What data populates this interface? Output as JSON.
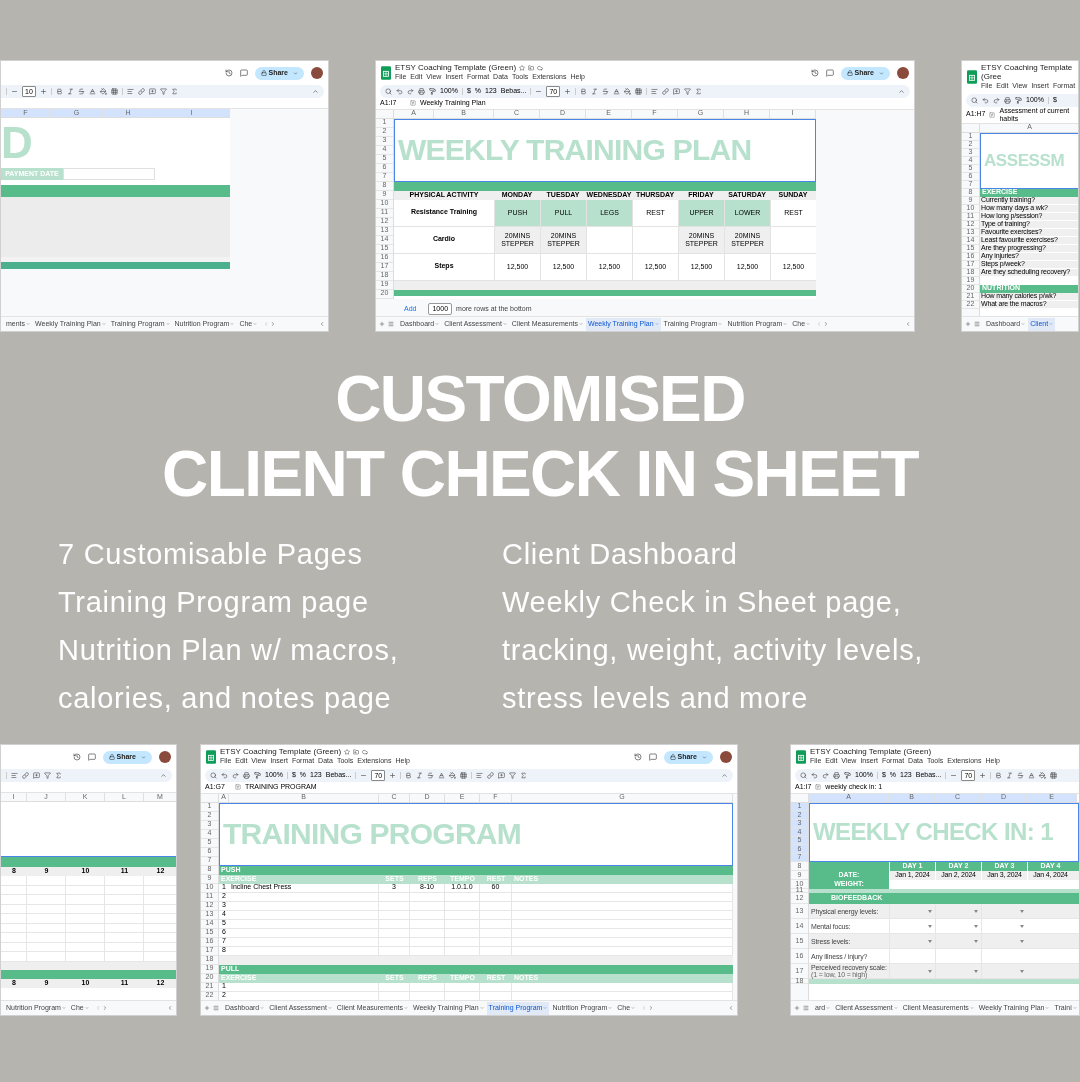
{
  "top_panels": [
    {
      "share": "Share",
      "toolbar": {
        "size": "10"
      },
      "body": {
        "kind": "dashboard",
        "columns": [
          "F",
          "G",
          "H",
          "I"
        ],
        "title": "D",
        "field_label": "PAYMENT DATE"
      },
      "tabs": [
        {
          "label": "ments",
          "selected": false
        },
        {
          "label": "Weekly Training Plan",
          "selected": false
        },
        {
          "label": "Training Program",
          "selected": false
        },
        {
          "label": "Nutrition Program",
          "selected": false
        },
        {
          "label": "Che",
          "selected": false
        }
      ]
    },
    {
      "doc_title": "ETSY Coaching Template (Green)",
      "menu": [
        "File",
        "Edit",
        "View",
        "Insert",
        "Format",
        "Data",
        "Tools",
        "Extensions",
        "Help"
      ],
      "share": "Share",
      "toolbar": {
        "zoom": "100%",
        "currency": "$",
        "percent": "%",
        "number_format": "123",
        "font": "Bebas...",
        "size": "70"
      },
      "formula": {
        "cell": "A1:I7",
        "text": "Weekly Training Plan"
      },
      "body": {
        "kind": "weekly_plan",
        "columns": [
          "A",
          "B",
          "C",
          "D",
          "E",
          "F",
          "G",
          "H",
          "I"
        ],
        "row_numbers": [
          "1",
          "2",
          "3",
          "4",
          "5",
          "6",
          "7",
          "8",
          "9",
          "10",
          "11",
          "12",
          "13",
          "14",
          "15",
          "16",
          "17",
          "18",
          "19",
          "20"
        ],
        "title": "WEEKLY TRAINING PLAN",
        "header": [
          "PHYSICAL ACTIVITY",
          "MONDAY",
          "TUESDAY",
          "WEDNESDAY",
          "THURSDAY",
          "FRIDAY",
          "SATURDAY",
          "SUNDAY"
        ],
        "activities": [
          {
            "name": "Resistance Training",
            "cells": [
              {
                "text": "PUSH",
                "highlighted": true,
                "shaded": false
              },
              {
                "text": "PULL",
                "highlighted": true,
                "shaded": false
              },
              {
                "text": "LEGS",
                "highlighted": true,
                "shaded": false
              },
              {
                "text": "REST",
                "highlighted": false,
                "shaded": false
              },
              {
                "text": "UPPER",
                "highlighted": true,
                "shaded": false
              },
              {
                "text": "LOWER",
                "highlighted": true,
                "shaded": false
              },
              {
                "text": "REST",
                "highlighted": false,
                "shaded": false
              }
            ]
          },
          {
            "name": "Cardio",
            "cells": [
              {
                "text": "20MINS STEPPER",
                "highlighted": false,
                "shaded": true
              },
              {
                "text": "20MINS STEPPER",
                "highlighted": false,
                "shaded": true
              },
              {
                "highlighted": false,
                "shaded": false
              },
              {
                "highlighted": false,
                "shaded": false
              },
              {
                "text": "20MINS STEPPER",
                "highlighted": false,
                "shaded": true
              },
              {
                "text": "20MINS STEPPER",
                "highlighted": false,
                "shaded": true
              },
              {
                "highlighted": false,
                "shaded": false
              }
            ]
          },
          {
            "name": "Steps",
            "cells": [
              {
                "text": "12,500",
                "highlighted": false,
                "shaded": false
              },
              {
                "text": "12,500",
                "highlighted": false,
                "shaded": false
              },
              {
                "text": "12,500",
                "highlighted": false,
                "shaded": false
              },
              {
                "text": "12,500",
                "highlighted": false,
                "shaded": false
              },
              {
                "text": "12,500",
                "highlighted": false,
                "shaded": false
              },
              {
                "text": "12,500",
                "highlighted": false,
                "shaded": false
              },
              {
                "text": "12,500",
                "highlighted": false,
                "shaded": false
              }
            ]
          }
        ],
        "add_rows": {
          "button": "Add",
          "count": "1000",
          "text": "more rows at the bottom"
        }
      },
      "tabs": [
        {
          "label": "Dashboard",
          "selected": false
        },
        {
          "label": "Client Assessment",
          "selected": false
        },
        {
          "label": "Client Measurements",
          "selected": false
        },
        {
          "label": "Weekly Training Plan",
          "selected": true
        },
        {
          "label": "Training Program",
          "selected": false
        },
        {
          "label": "Nutrition Program",
          "selected": false
        },
        {
          "label": "Che",
          "selected": false
        }
      ]
    },
    {
      "doc_title": "ETSY Coaching Template (Gree",
      "menu": [
        "File",
        "Edit",
        "View",
        "Insert",
        "Format"
      ],
      "toolbar": {
        "zoom": "100%",
        "currency": "$"
      },
      "formula": {
        "cell": "A1:H7",
        "text": "Assessment of current habits"
      },
      "body": {
        "kind": "assessment",
        "columns": [
          "A"
        ],
        "row_numbers": [
          "1",
          "2",
          "3",
          "4",
          "5",
          "6",
          "7",
          "8",
          "9",
          "10",
          "11",
          "12",
          "13",
          "14",
          "15",
          "16",
          "17",
          "18",
          "19",
          "20",
          "21",
          "22"
        ],
        "title": "ASSESSM",
        "sections": [
          {
            "name": "EXERCISE",
            "questions": [
              "Currently training?",
              "How many days a wk?",
              "How long p/session?",
              "Type of training?",
              "Favourite exercises?",
              "Least favourite exercises?",
              "Are they progressing?",
              "Any injuries?",
              "Steps p/week?",
              "Are they scheduling recovery?"
            ]
          },
          {
            "name": "NUTRITION",
            "questions": [
              "How many calories p/wk?",
              "What are the macros?"
            ]
          }
        ]
      },
      "tabs": [
        {
          "label": "Dashboard",
          "selected": false
        },
        {
          "label": "Client",
          "selected": true
        }
      ]
    }
  ],
  "headline": [
    "CUSTOMISED",
    "CLIENT CHECK IN SHEET"
  ],
  "features_left": [
    "7 Customisable Pages",
    "Training Program page",
    "Nutrition Plan w/ macros,",
    "calories, and notes page"
  ],
  "features_right": [
    "Client Dashboard",
    "Weekly Check in Sheet page,",
    "tracking, weight, activity levels,",
    "stress levels and more"
  ],
  "bottom_panels": [
    {
      "share": "Share",
      "body": {
        "kind": "week_grid",
        "columns": [
          "I",
          "J",
          "K",
          "L",
          "M"
        ],
        "bands": [
          [
            "8",
            "9",
            "10",
            "11",
            "12"
          ],
          [
            "8",
            "9",
            "10",
            "11",
            "12"
          ]
        ]
      },
      "tabs": [
        {
          "label": "Nutrition Program",
          "selected": false
        },
        {
          "label": "Che",
          "selected": false
        }
      ]
    },
    {
      "doc_title": "ETSY Coaching Template (Green)",
      "menu": [
        "File",
        "Edit",
        "View",
        "Insert",
        "Format",
        "Data",
        "Tools",
        "Extensions",
        "Help"
      ],
      "share": "Share",
      "toolbar": {
        "zoom": "100%",
        "currency": "$",
        "percent": "%",
        "number_format": "123",
        "font": "Bebas...",
        "size": "70"
      },
      "formula": {
        "cell": "A1:G7",
        "text": "TRAINING PROGRAM"
      },
      "body": {
        "kind": "training",
        "columns": [
          "A",
          "B",
          "C",
          "D",
          "E",
          "F",
          "G"
        ],
        "row_numbers": [
          "1",
          "2",
          "3",
          "4",
          "5",
          "6",
          "7",
          "8",
          "9",
          "10",
          "11",
          "12",
          "13",
          "14",
          "15",
          "16",
          "17",
          "18",
          "19",
          "20",
          "21",
          "22"
        ],
        "title": "TRAINING PROGRAM",
        "sections": [
          {
            "name": "PUSH",
            "header": [
              "EXERCISE",
              "SETS",
              "REPS",
              "TEMPO",
              "REST",
              "NOTES"
            ],
            "rows": [
              {
                "number": "1",
                "cells": [
                  "Incline Chest Press",
                  "3",
                  "8-10",
                  "1.0.1.0",
                  "60"
                ]
              },
              {
                "number": "2"
              },
              {
                "number": "3"
              },
              {
                "number": "4"
              },
              {
                "number": "5"
              },
              {
                "number": "6"
              },
              {
                "number": "7"
              },
              {
                "number": "8"
              }
            ]
          },
          {
            "name": "PULL",
            "header": [
              "EXERCISE",
              "SETS",
              "REPS",
              "TEMPO",
              "REST",
              "NOTES"
            ],
            "rows": [
              {
                "number": "1"
              },
              {
                "number": "2"
              }
            ]
          }
        ]
      },
      "tabs": [
        {
          "label": "Dashboard",
          "selected": false
        },
        {
          "label": "Client Assessment",
          "selected": false
        },
        {
          "label": "Client Measurements",
          "selected": false
        },
        {
          "label": "Weekly Training Plan",
          "selected": false
        },
        {
          "label": "Training Program",
          "selected": true
        },
        {
          "label": "Nutrition Program",
          "selected": false
        },
        {
          "label": "Che",
          "selected": false
        }
      ]
    },
    {
      "doc_title": "ETSY Coaching Template (Green)",
      "menu": [
        "File",
        "Edit",
        "View",
        "Insert",
        "Format",
        "Data",
        "Tools",
        "Extensions",
        "Help"
      ],
      "toolbar": {
        "zoom": "100%",
        "currency": "$",
        "percent": "%",
        "number_format": "123",
        "font": "Bebas...",
        "size": "70"
      },
      "formula": {
        "cell": "A1:I7",
        "text": "weekly check in: 1"
      },
      "body": {
        "kind": "check_in",
        "columns": [
          "A",
          "B",
          "C",
          "D",
          "E"
        ],
        "row_numbers": [
          "1",
          "2",
          "3",
          "4",
          "5",
          "6",
          "7",
          "8",
          "9",
          "10",
          "11",
          "12",
          "13",
          "14",
          "15",
          "16",
          "17",
          "18"
        ],
        "title": "WEEKLY CHECK IN: 1",
        "days": [
          "DAY 1",
          "DAY 2",
          "DAY 3",
          "DAY 4"
        ],
        "date_label": "DATE:",
        "dates": [
          "Jan 1, 2024",
          "Jan 2, 2024",
          "Jan 3, 2024",
          "Jan 4, 2024"
        ],
        "weight_label": "WEIGHT:",
        "section": "BIOFEEDBACK",
        "questions": [
          {
            "text": "Physical energy levels:",
            "dropdown": true
          },
          {
            "text": "Mental focus:",
            "dropdown": true
          },
          {
            "text": "Stress levels:",
            "dropdown": true
          },
          {
            "text": "Any illness / injury?",
            "dropdown": false
          },
          {
            "text": "Perceived recovery scale:",
            "note": "(1 = low, 10 = high)",
            "dropdown": true
          }
        ]
      },
      "tabs": [
        {
          "label": "ard",
          "selected": false
        },
        {
          "label": "Client Assessment",
          "selected": false
        },
        {
          "label": "Client Measurements",
          "selected": false
        },
        {
          "label": "Weekly Training Plan",
          "selected": false
        },
        {
          "label": "Traini",
          "selected": false
        }
      ]
    }
  ]
}
